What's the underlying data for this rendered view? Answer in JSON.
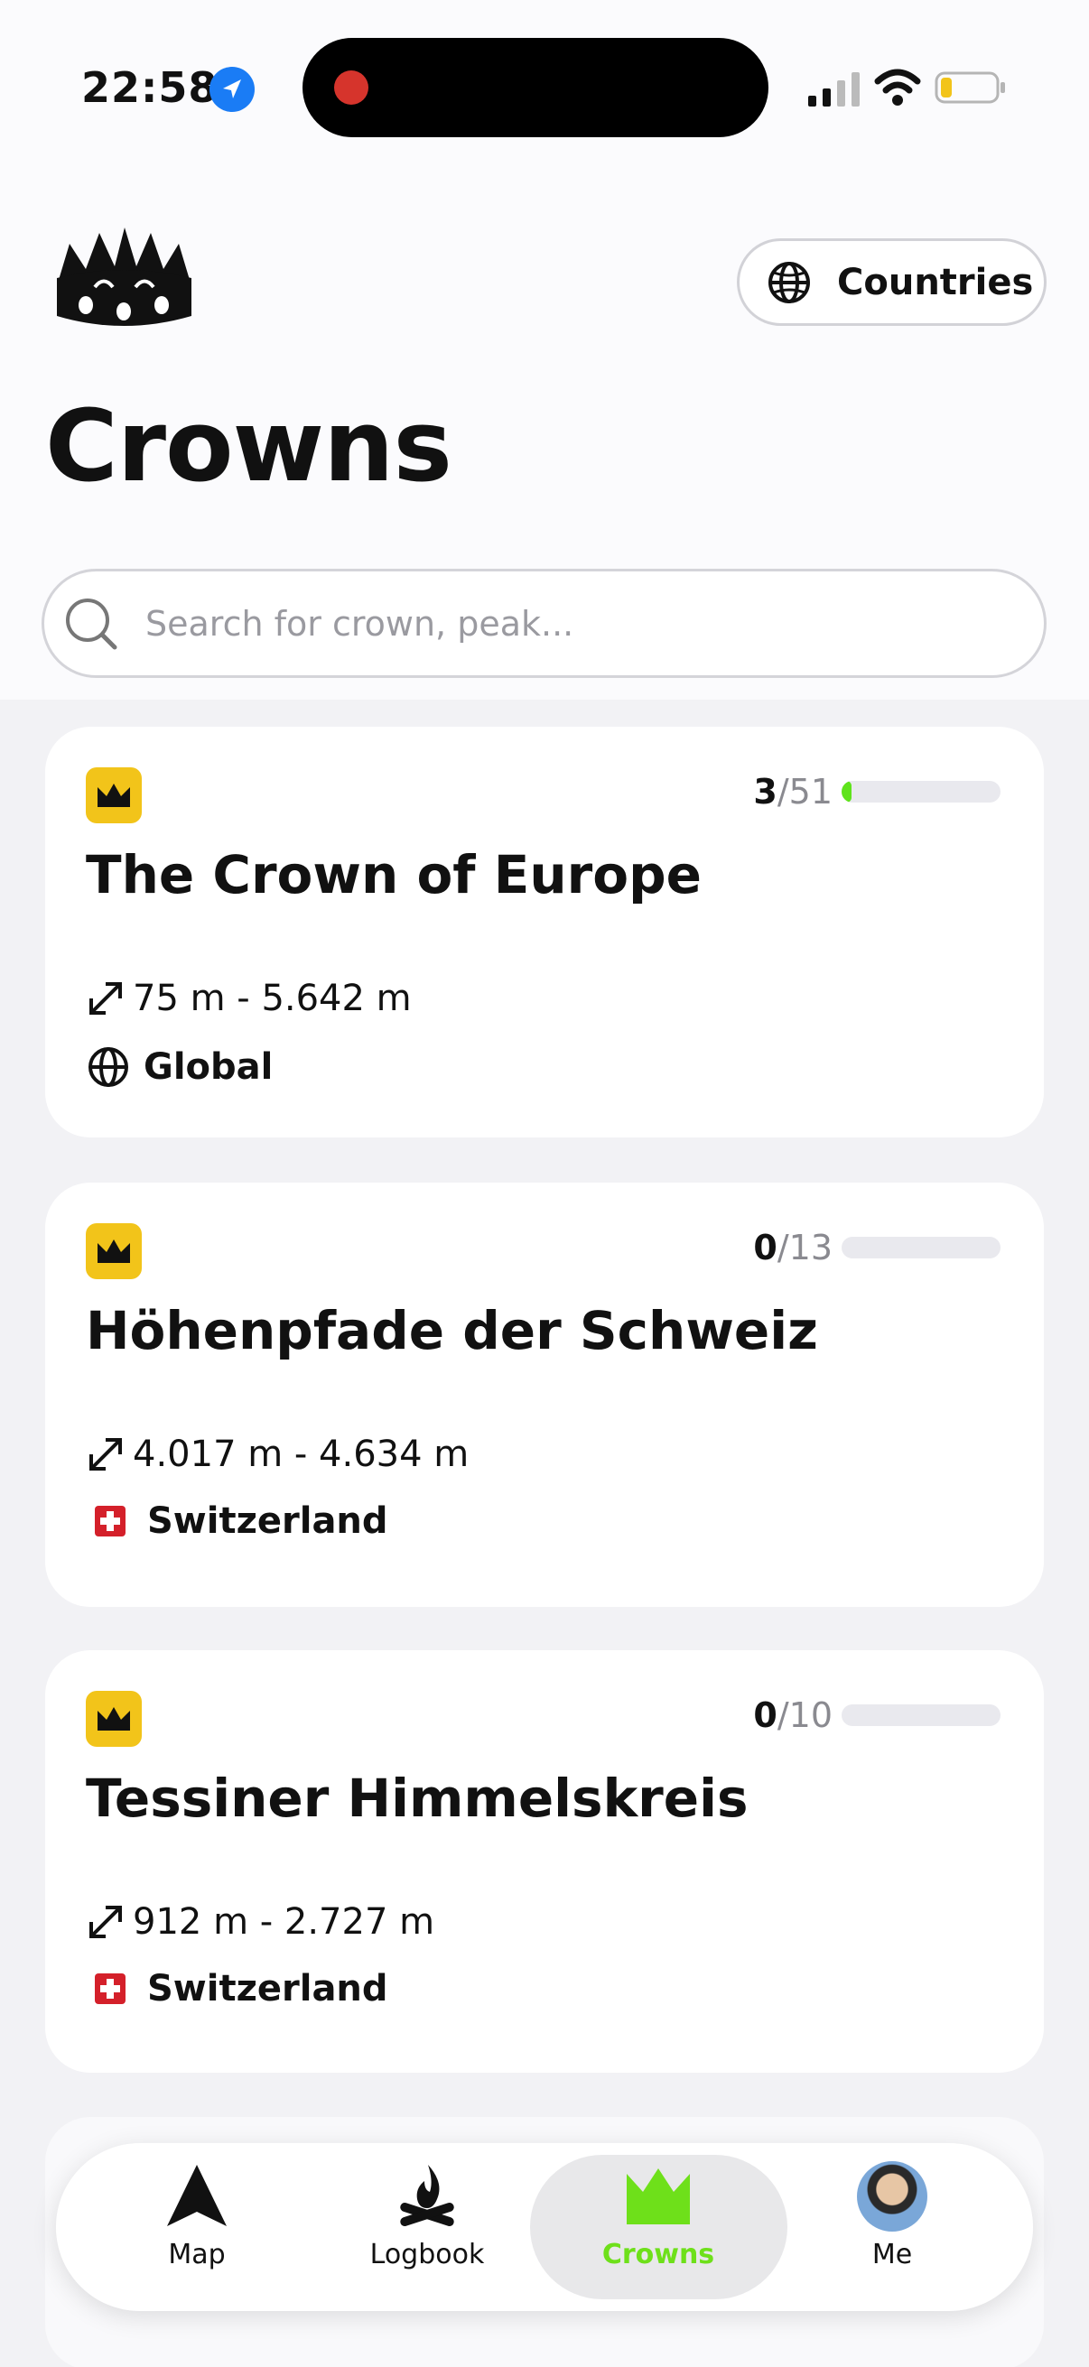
{
  "status_bar": {
    "time": "22:58"
  },
  "header": {
    "countries_label": "Countries",
    "title": "Crowns"
  },
  "search": {
    "placeholder": "Search for crown, peak..."
  },
  "crowns": [
    {
      "title": "The Crown of Europe",
      "completed": "3",
      "total": "/51",
      "progress": 0.059,
      "range": "75 m - 5.642 m",
      "region": "Global",
      "region_icon": "globe-icon"
    },
    {
      "title": "Höhenpfade der Schweiz",
      "completed": "0",
      "total": "/13",
      "progress": 0,
      "range": "4.017 m - 4.634 m",
      "region": "Switzerland",
      "region_icon": "swiss-flag-icon"
    },
    {
      "title": "Tessiner Himmelskreis",
      "completed": "0",
      "total": "/10",
      "progress": 0,
      "range": "912 m - 2.727 m",
      "region": "Switzerland",
      "region_icon": "swiss-flag-icon"
    }
  ],
  "nav": {
    "items": [
      {
        "label": "Map",
        "icon": "map-arrow-icon"
      },
      {
        "label": "Logbook",
        "icon": "campfire-icon"
      },
      {
        "label": "Crowns",
        "icon": "crown-icon",
        "active": true
      },
      {
        "label": "Me",
        "icon": "avatar"
      }
    ]
  },
  "colors": {
    "accent": "#6ee01a",
    "badge": "#f2c41a",
    "progress_fill": "#5fe31c"
  }
}
